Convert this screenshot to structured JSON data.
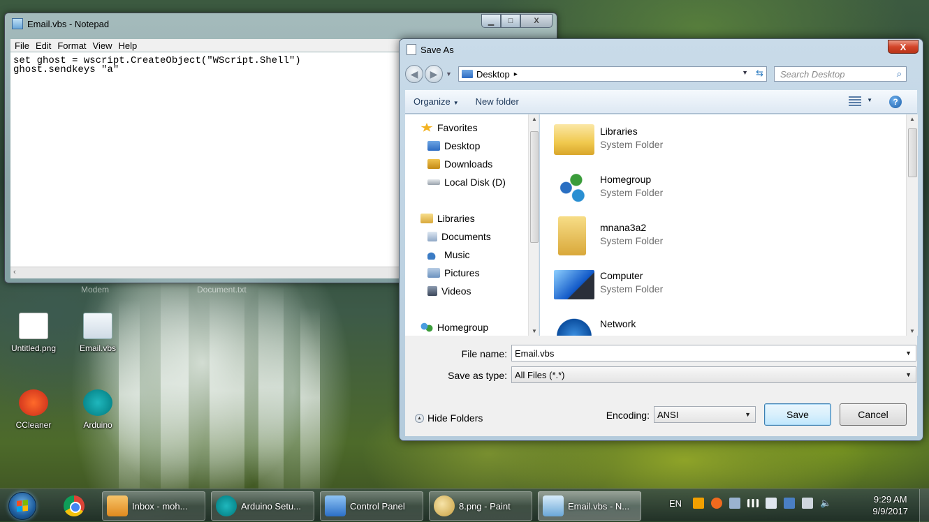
{
  "desktop": {
    "faded_labels": [
      "Modem",
      "Document.txt"
    ],
    "icons": [
      {
        "label": "Untitled.png"
      },
      {
        "label": "Email.vbs"
      },
      {
        "label": "CCleaner"
      },
      {
        "label": "Arduino"
      }
    ]
  },
  "notepad": {
    "title": "Email.vbs - Notepad",
    "menu": [
      "File",
      "Edit",
      "Format",
      "View",
      "Help"
    ],
    "content": "set ghost = wscript.CreateObject(\"WScript.Shell\")\nghost.sendkeys \"a\"",
    "minimize_symbol": "▁",
    "maximize_symbol": "□",
    "close_symbol": "X",
    "scroll_left_symbol": "‹"
  },
  "save_as": {
    "title": "Save As",
    "close_symbol": "X",
    "address": {
      "location": "Desktop",
      "chevron": "▸"
    },
    "search_placeholder": "Search Desktop",
    "toolbar": {
      "organize": "Organize",
      "new_folder": "New folder",
      "help": "?"
    },
    "nav_pane": {
      "items": [
        {
          "label": "Favorites",
          "icon": "star-icon",
          "color": "#f3b221"
        },
        {
          "label": "Desktop",
          "icon": "desktop-icon",
          "color": "#2c6bc2"
        },
        {
          "label": "Downloads",
          "icon": "downloads-icon",
          "color": "#2c6bc2"
        },
        {
          "label": "Local Disk (D)",
          "icon": "drive-icon",
          "color": "#9aa3ad"
        },
        {
          "label": "Libraries",
          "icon": "libraries-icon",
          "color": "#e8c45a"
        },
        {
          "label": "Documents",
          "icon": "documents-icon",
          "color": "#8fa8c6"
        },
        {
          "label": "Music",
          "icon": "music-icon",
          "color": "#3b7bc4"
        },
        {
          "label": "Pictures",
          "icon": "pictures-icon",
          "color": "#6c92bf"
        },
        {
          "label": "Videos",
          "icon": "videos-icon",
          "color": "#4a5a72"
        },
        {
          "label": "Homegroup",
          "icon": "homegroup-icon",
          "color": "#3a8c3a"
        }
      ]
    },
    "files": [
      {
        "name": "Libraries",
        "type": "System Folder",
        "icon": "libraries-folder-icon"
      },
      {
        "name": "Homegroup",
        "type": "System Folder",
        "icon": "homegroup-icon"
      },
      {
        "name": "mnana3a2",
        "type": "System Folder",
        "icon": "user-folder-icon"
      },
      {
        "name": "Computer",
        "type": "System Folder",
        "icon": "computer-icon"
      },
      {
        "name": "Network",
        "type": "",
        "icon": "network-icon"
      }
    ],
    "form": {
      "file_name_label": "File name:",
      "file_name_value": "Email.vbs",
      "save_as_type_label": "Save as type:",
      "save_as_type_value": "All Files  (*.*)",
      "encoding_label": "Encoding:",
      "encoding_value": "ANSI",
      "hide_folders": "Hide Folders",
      "save_button": "Save",
      "cancel_button": "Cancel"
    }
  },
  "taskbar": {
    "buttons": [
      {
        "label": "Inbox - moh...",
        "icon": "outlook-icon",
        "color": "#e8a43a"
      },
      {
        "label": "Arduino Setu...",
        "icon": "arduino-icon",
        "color": "#00979c"
      },
      {
        "label": "Control Panel",
        "icon": "control-panel-icon",
        "color": "#3a7fd0"
      },
      {
        "label": "8.png - Paint",
        "icon": "paint-icon",
        "color": "#c9a040"
      },
      {
        "label": "Email.vbs - N...",
        "icon": "notepad-icon",
        "color": "#6aa7d8"
      }
    ],
    "tray": {
      "language": "EN",
      "time": "9:29 AM",
      "date": "9/9/2017"
    }
  }
}
